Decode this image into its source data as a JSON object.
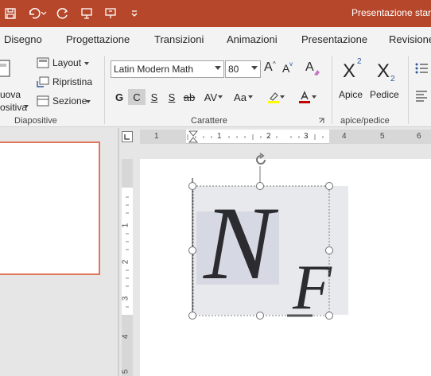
{
  "titlebar": {
    "title": "Presentazione star",
    "qat": {
      "save_icon": "save-icon",
      "undo_icon": "undo-icon",
      "redo_icon": "redo-icon",
      "slideshow_icon": "start-slideshow-icon",
      "present_icon": "present-icon",
      "customize_icon": "customize-qat-icon"
    }
  },
  "tabs": [
    "Disegno",
    "Progettazione",
    "Transizioni",
    "Animazioni",
    "Presentazione",
    "Revisione"
  ],
  "ribbon": {
    "slides_group": {
      "label": "Diapositive",
      "new_slide_line1": "uova",
      "new_slide_line2": "ositiva",
      "layout": "Layout",
      "reset": "Ripristina",
      "section": "Sezione"
    },
    "font_group": {
      "label": "Carattere",
      "font_name": "Latin Modern Math",
      "font_size": "80",
      "grow": "A",
      "shrink": "A",
      "clear": "A",
      "bold": "G",
      "italic": "C",
      "underline": "S",
      "shadow": "S",
      "strike": "ab",
      "spacing": "AV",
      "case": "Aa",
      "highlight_color": "#ffff00",
      "font_color": "#c00000"
    },
    "script_group": {
      "label": "apice/pedice",
      "superscript_label": "Apice",
      "subscript_label": "Pedice",
      "superscript_glyph": "X",
      "superscript_mark": "2",
      "subscript_glyph": "X",
      "subscript_mark": "2"
    }
  },
  "ruler": {
    "h_numbers": [
      "1",
      "1",
      "2",
      "3",
      "4",
      "5",
      "6"
    ],
    "v_numbers": [
      "1",
      "2",
      "3",
      "4",
      "5"
    ]
  },
  "slide": {
    "main_symbol": "N",
    "sub_symbol": "F"
  },
  "colors": {
    "accent": "#b7472a",
    "selection_border": "#e0775a"
  }
}
